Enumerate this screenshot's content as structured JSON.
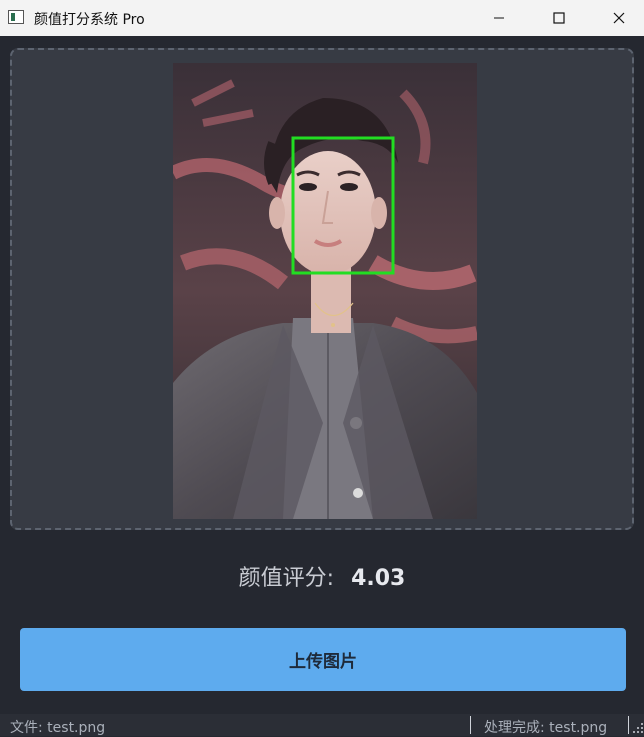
{
  "window": {
    "title": "颜值打分系统 Pro"
  },
  "score": {
    "label": "颜值评分:",
    "value": "4.03"
  },
  "upload_button": {
    "label": "上传图片"
  },
  "statusbar": {
    "file_text": "文件: test.png",
    "status_text": "处理完成: test.png"
  },
  "face_box_color": "#22dd22",
  "icons": [
    "app-icon",
    "minimize-icon",
    "maximize-icon",
    "close-icon",
    "resize-grip-icon"
  ]
}
